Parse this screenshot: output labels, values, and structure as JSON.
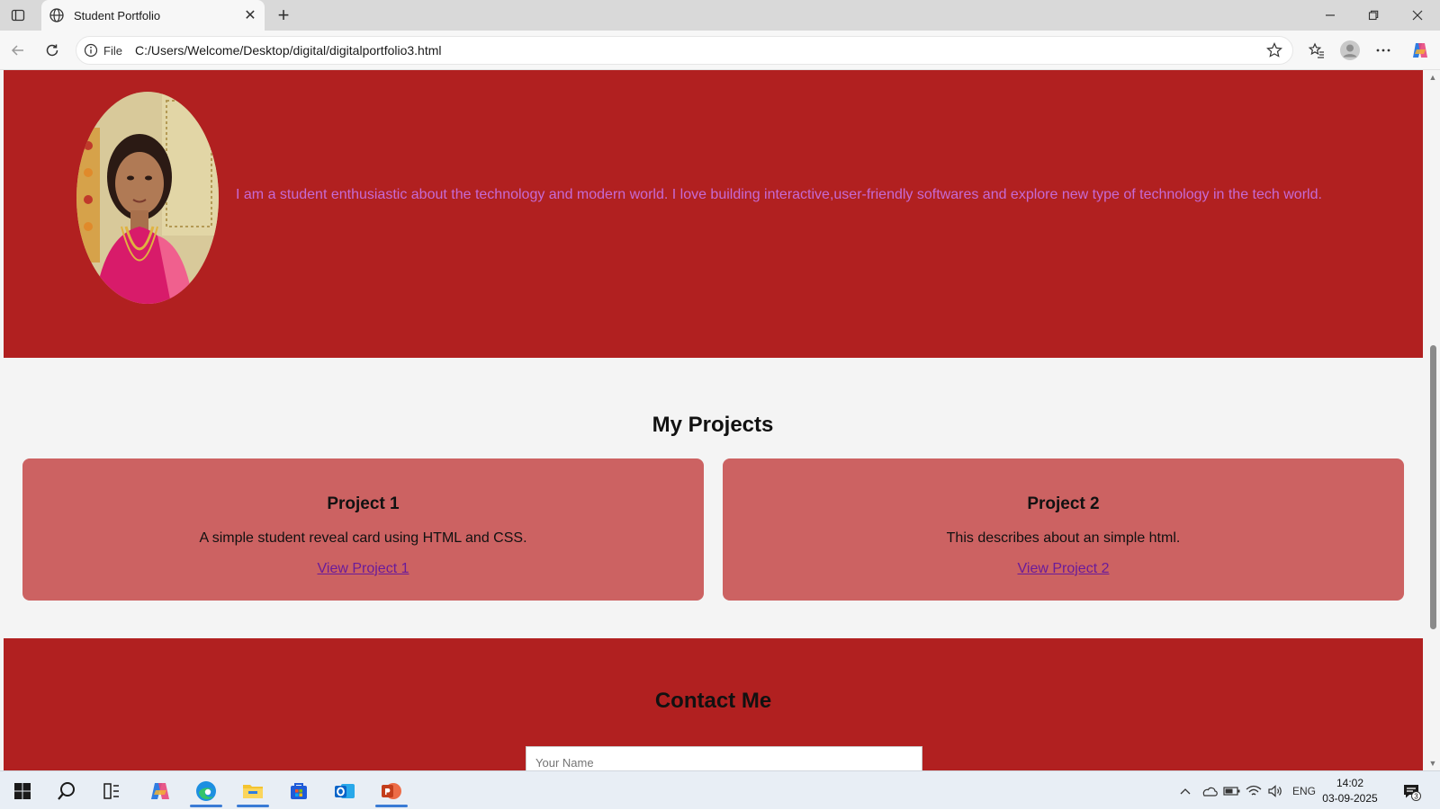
{
  "browser": {
    "tab_title": "Student Portfolio",
    "address_prefix": "File",
    "url": "C:/Users/Welcome/Desktop/digital/digitalportfolio3.html",
    "icons": [
      "tab-actions-icon",
      "globe-icon",
      "close-icon",
      "plus-icon",
      "minimize-icon",
      "restore-icon",
      "window-close-icon",
      "back-icon",
      "refresh-icon",
      "info-icon",
      "star-icon",
      "favorites-icon",
      "profile-icon",
      "more-icon",
      "copilot-icon"
    ]
  },
  "page": {
    "hero": {
      "bio": "I am a student enthusiastic about the technology and modern world. I love building interactive,user-friendly softwares and explore new type of technology in the tech world.",
      "bg_color": "#b12020",
      "text_color": "#c66ad4"
    },
    "projects": {
      "title": "My Projects",
      "items": [
        {
          "title": "Project 1",
          "description": "A simple student reveal card using HTML and CSS.",
          "link": "View Project 1"
        },
        {
          "title": "Project 2",
          "description": "This describes about an simple html.",
          "link": "View Project 2"
        }
      ],
      "card_color": "#cc6262"
    },
    "contact": {
      "title": "Contact Me",
      "name_placeholder": "Your Name"
    }
  },
  "taskbar": {
    "apps": [
      "windows-start-icon",
      "search-icon",
      "task-view-icon",
      "copilot-app-icon",
      "edge-icon",
      "file-explorer-icon",
      "store-icon",
      "outlook-icon",
      "powerpoint-icon"
    ],
    "tray": {
      "language": "ENG",
      "time": "14:02",
      "date": "03-09-2025",
      "notification_count": "3"
    }
  }
}
